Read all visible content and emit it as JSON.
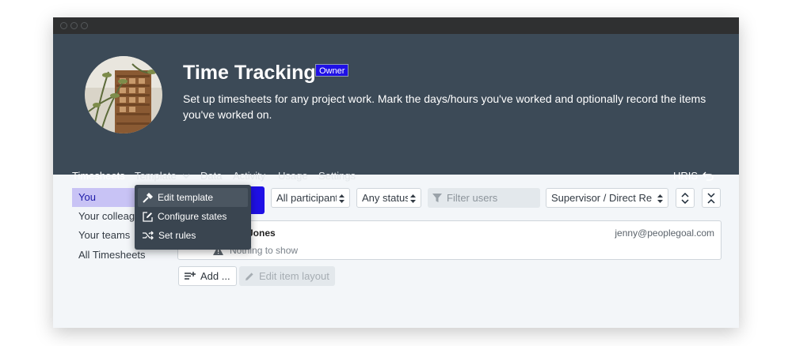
{
  "app": {
    "title": "Time Tracking",
    "role_badge": "Owner",
    "description": "Set up timesheets for any project work. Mark the days/hours you've worked and optionally record the items you've worked on."
  },
  "nav": {
    "tabs": [
      {
        "label": "Timesheets",
        "active": true
      },
      {
        "label": "Template",
        "has_dropdown": true
      },
      {
        "label": "Data"
      },
      {
        "label": "Activity"
      },
      {
        "label": "Usage"
      },
      {
        "label": "Settings"
      }
    ],
    "hris_label": "HRIS"
  },
  "template_menu": {
    "items": [
      {
        "label": "Edit template",
        "icon": "hammer-icon"
      },
      {
        "label": "Configure states",
        "icon": "edit-square-icon"
      },
      {
        "label": "Set rules",
        "icon": "shuffle-icon"
      }
    ]
  },
  "sidebar": {
    "items": [
      {
        "label": "You",
        "active": true
      },
      {
        "label": "Your colleagues"
      },
      {
        "label": "Your teams"
      },
      {
        "label": "All Timesheets"
      }
    ]
  },
  "filters": {
    "participants": "All participants",
    "status": "Any status",
    "filter_placeholder": "Filter users",
    "relationship": "Supervisor / Direct Reports"
  },
  "user_card": {
    "name_visible": "Jones",
    "email": "jenny@peoplegoal.com",
    "empty_text": "Nothing to show"
  },
  "actions": {
    "add_label": "Add ...",
    "edit_layout_label": "Edit item layout"
  },
  "colors": {
    "header_bg": "#3c4a57",
    "accent_blue": "#1f10e6",
    "tab_underline": "#e0367a"
  }
}
